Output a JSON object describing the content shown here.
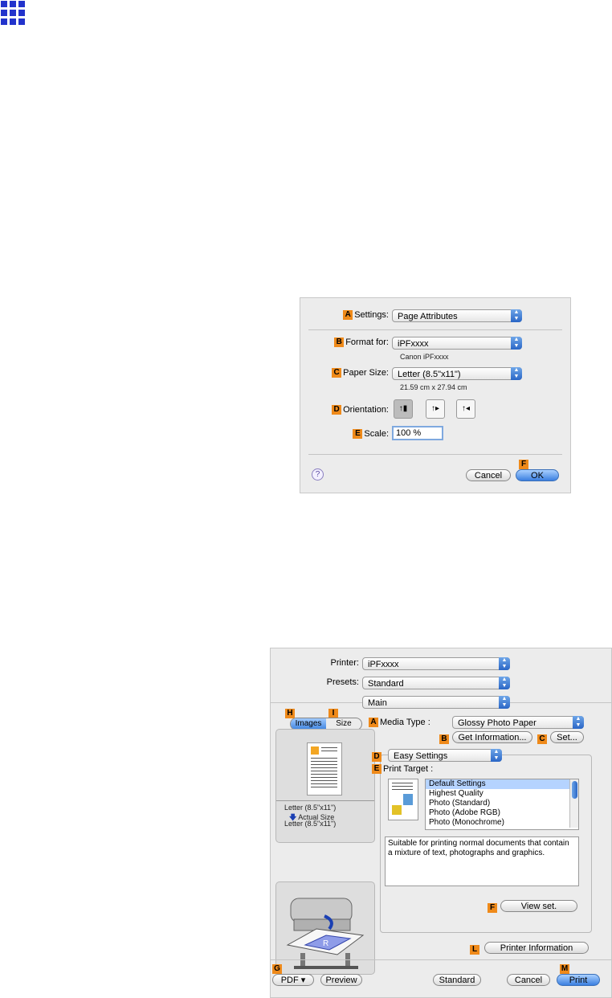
{
  "corner_icon": "grid-icon",
  "page_setup": {
    "settings_label": "Settings:",
    "settings_value": "Page Attributes",
    "format_label": "Format for:",
    "format_value": "iPFxxxx",
    "format_sub": "Canon iPFxxxx",
    "paper_label": "Paper Size:",
    "paper_value": "Letter (8.5\"x11\")",
    "paper_sub": "21.59 cm x 27.94 cm",
    "orientation_label": "Orientation:",
    "scale_label": "Scale:",
    "scale_value": "100 %",
    "cancel": "Cancel",
    "ok": "OK",
    "help": "?",
    "tags": {
      "a": "A",
      "b": "B",
      "c": "C",
      "d": "D",
      "e": "E",
      "f": "F"
    }
  },
  "print_dialog": {
    "printer_label": "Printer:",
    "printer_value": "iPFxxxx",
    "presets_label": "Presets:",
    "presets_value": "Standard",
    "pane_value": "Main",
    "tab_images": "Images",
    "tab_size": "Size",
    "media_type_label": "Media Type :",
    "media_type_value": "Glossy Photo Paper",
    "get_info": "Get Information...",
    "set": "Set...",
    "mode_value": "Easy Settings",
    "print_target_label": "Print Target :",
    "targets": [
      "Default Settings",
      "Highest Quality",
      "Photo (Standard)",
      "Photo (Adobe RGB)",
      "Photo (Monochrome)"
    ],
    "description": "Suitable for printing normal documents that contain a mixture of text, photographs and graphics.",
    "view_set": "View set.",
    "printer_info": "Printer Information",
    "size_line1": "Letter (8.5\"x11\")",
    "size_line2": "Actual Size",
    "size_line3": "Letter (8.5\"x11\")",
    "pdf": "PDF ▾",
    "preview": "Preview",
    "standard": "Standard",
    "cancel": "Cancel",
    "print": "Print",
    "tags": {
      "h": "H",
      "i": "I",
      "a": "A",
      "b": "B",
      "c": "C",
      "d": "D",
      "e": "E",
      "f": "F",
      "l": "L",
      "g": "G",
      "m": "M"
    }
  }
}
